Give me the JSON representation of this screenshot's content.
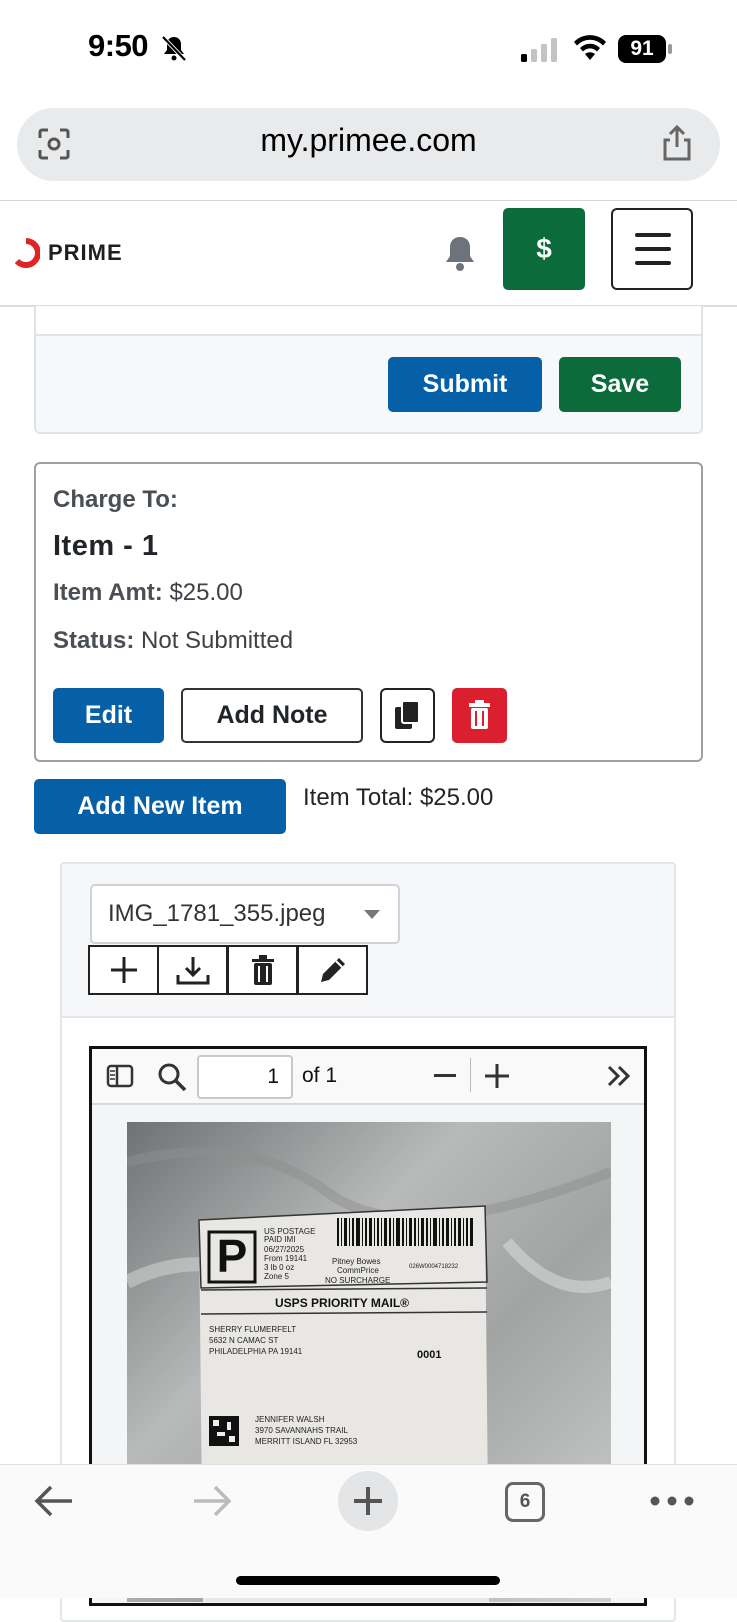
{
  "status_bar": {
    "time": "9:50",
    "battery": "91"
  },
  "browser": {
    "url": "my.primee.com",
    "tabs_count": "6"
  },
  "header": {
    "logo_text": "PRIME",
    "dollar_label": "$"
  },
  "form_actions": {
    "submit_label": "Submit",
    "save_label": "Save"
  },
  "item_card": {
    "charge_to_label": "Charge To:",
    "title": "Item - 1",
    "amount_label": "Item Amt:",
    "amount_value": "$25.00",
    "status_label": "Status:",
    "status_value": "Not Submitted",
    "edit_label": "Edit",
    "add_note_label": "Add Note"
  },
  "add_new_item_label": "Add New Item",
  "item_total": "Item Total: $25.00",
  "attachments": {
    "selected_file": "IMG_1781_355.jpeg"
  },
  "pdf_viewer": {
    "page_number": "1",
    "page_count_text": "of 1"
  },
  "shipping_label": {
    "postage_line1": "US POSTAGE",
    "postage_line2": "PAID IMI",
    "date": "06/27/2025",
    "from": "From 19141",
    "weight": "3 lb 0 oz",
    "zone": "Zone 5",
    "carrier1": "Pitney Bowes",
    "carrier2": "CommPrice",
    "surcharge": "NO SURCHARGE",
    "code": "026W0004718232",
    "service": "USPS PRIORITY MAIL®",
    "sender1": "SHERRY FLUMERFELT",
    "sender2": "5632 N CAMAC ST",
    "sender3": "PHILADELPHIA PA 19141",
    "number": "0001",
    "recipient1": "JENNIFER WALSH",
    "recipient2": "3970 SAVANNAHS TRAIL",
    "recipient3": "MERRITT ISLAND FL 32953"
  },
  "colors": {
    "primary_blue": "#0560a8",
    "save_green": "#0b6b3a",
    "danger_red": "#dc1f2e",
    "logo_red": "#e02424"
  }
}
